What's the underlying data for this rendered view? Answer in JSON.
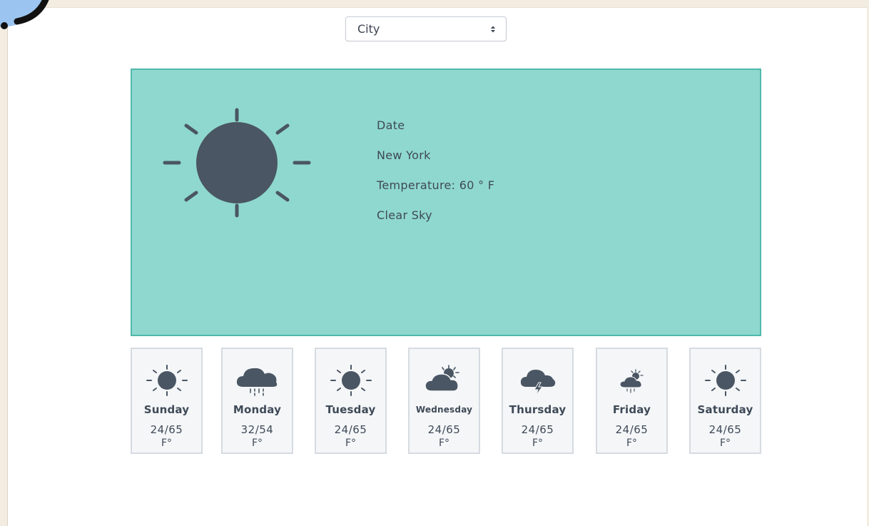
{
  "city_select": {
    "selected": "City"
  },
  "current": {
    "icon": "sun-icon",
    "date": "Date",
    "city": "New York",
    "temperature": "Temperature: 60 ° F",
    "description": "Clear Sky"
  },
  "colors": {
    "panel_bg": "#8fd8cf",
    "panel_border": "#4fb8aa",
    "icon": "#4a5663",
    "card_bg": "#f4f6f8",
    "card_border": "#d6dbe1"
  },
  "forecast": [
    {
      "day": "Sunday",
      "temp": "24/65",
      "unit": "F°",
      "icon": "sun-icon"
    },
    {
      "day": "Monday",
      "temp": "32/54",
      "unit": "F°",
      "icon": "rain-cloud-icon"
    },
    {
      "day": "Tuesday",
      "temp": "24/65",
      "unit": "F°",
      "icon": "sun-icon"
    },
    {
      "day": "Wednesday",
      "temp": "24/65",
      "unit": "F°",
      "icon": "partly-cloudy-icon"
    },
    {
      "day": "Thursday",
      "temp": "24/65",
      "unit": "F°",
      "icon": "thunderstorm-icon"
    },
    {
      "day": "Friday",
      "temp": "24/65",
      "unit": "F°",
      "icon": "partly-cloudy-rain-icon"
    },
    {
      "day": "Saturday",
      "temp": "24/65",
      "unit": "F°",
      "icon": "sun-icon"
    }
  ]
}
